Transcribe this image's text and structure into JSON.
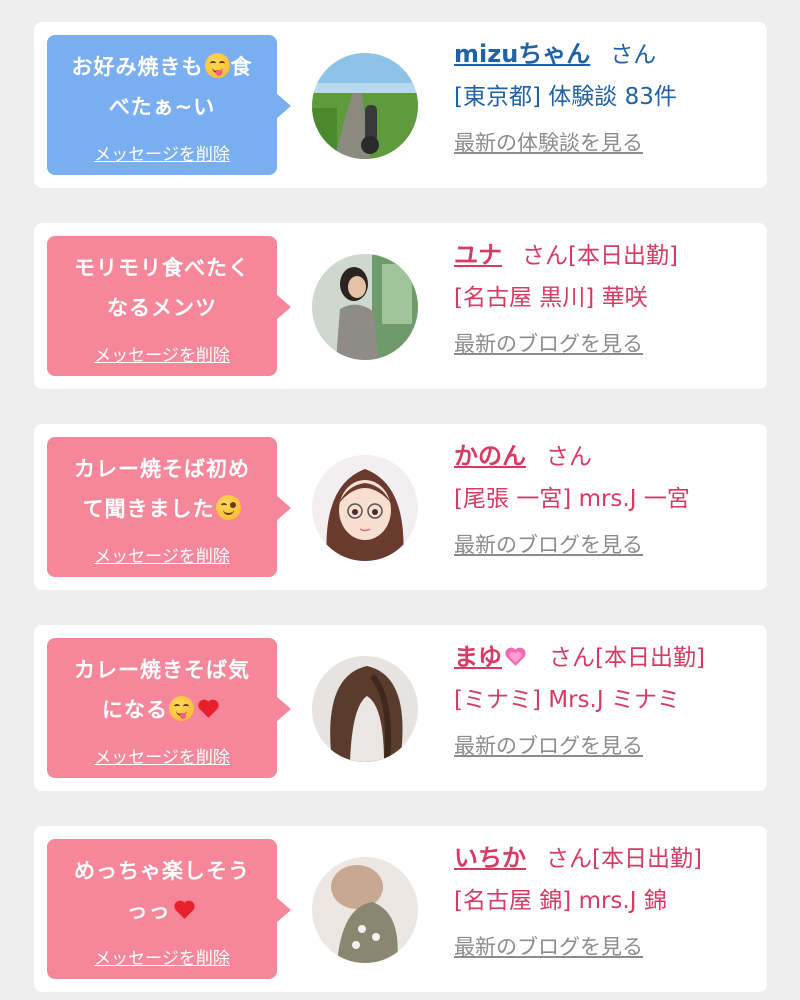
{
  "cards": [
    {
      "bubble_color": "#79aef0",
      "text_color": "#2161a8",
      "message_parts": [
        "お好み焼きも",
        "食\nべたぁ~い"
      ],
      "emoji": [
        "yum-face-icon"
      ],
      "delete_label": "メッセージを削除",
      "name": "mizuちゃん",
      "honorific": "さん",
      "location": "[東京都] 体験談 83件",
      "latest_link": "最新の体験談を見る",
      "avatar": "road-photo-avatar"
    },
    {
      "bubble_color": "#f6879b",
      "text_color": "#d63b63",
      "message_parts": [
        "モリモリ食べたく\nなるメンツ"
      ],
      "emoji": [],
      "delete_label": "メッセージを削除",
      "name": "ユナ",
      "honorific": "さん[本日出勤]",
      "location": "[名古屋 黒川] 華咲",
      "latest_link": "最新のブログを見る",
      "avatar": "woman-photo-avatar"
    },
    {
      "bubble_color": "#f6879b",
      "text_color": "#d63b63",
      "message_parts": [
        "カレー焼そば初め\nて聞きました"
      ],
      "emoji": [
        "wink-face-icon"
      ],
      "delete_label": "メッセージを削除",
      "name": "かのん",
      "honorific": "さん",
      "location": "[尾張 一宮] mrs.J 一宮",
      "latest_link": "最新のブログを見る",
      "avatar": "anime-girl-avatar"
    },
    {
      "bubble_color": "#f6879b",
      "text_color": "#d63b63",
      "message_parts": [
        "カレー焼きそば気\nになる"
      ],
      "emoji": [
        "yum-face-icon",
        "red-heart-icon"
      ],
      "delete_label": "メッセージを削除",
      "name": "まゆ",
      "honorific": "さん[本日出勤]",
      "location": "[ミナミ] Mrs.J ミナミ",
      "latest_link": "最新のブログを見る",
      "avatar": "hair-photo-avatar"
    },
    {
      "bubble_color": "#f6879b",
      "text_color": "#d63b63",
      "message_parts": [
        "めっちゃ楽しそう\nっっ"
      ],
      "emoji": [
        "red-heart-icon"
      ],
      "delete_label": "メッセージを削除",
      "name": "いちか",
      "honorific": "さん[本日出勤]",
      "location": "[名古屋 錦] mrs.J 錦",
      "latest_link": "最新のブログを見る",
      "avatar": "blurred-photo-avatar"
    }
  ]
}
